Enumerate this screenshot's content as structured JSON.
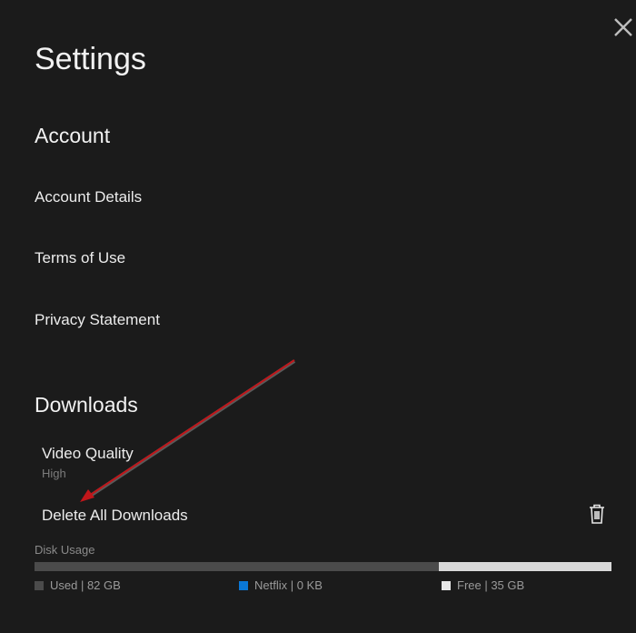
{
  "title": "Settings",
  "account": {
    "heading": "Account",
    "items": [
      "Account Details",
      "Terms of Use",
      "Privacy Statement"
    ]
  },
  "downloads": {
    "heading": "Downloads",
    "video_quality_label": "Video Quality",
    "video_quality_value": "High",
    "delete_all_label": "Delete All Downloads"
  },
  "disk_usage": {
    "label": "Disk Usage",
    "used_fraction": 0.7,
    "legend": {
      "used": "Used | 82 GB",
      "netflix": "Netflix | 0 KB",
      "free": "Free | 35 GB"
    },
    "colors": {
      "used": "#4b4b4b",
      "netflix": "#0a78d7",
      "free": "#d9d9d9"
    }
  },
  "annotation_color": "#c0161a"
}
